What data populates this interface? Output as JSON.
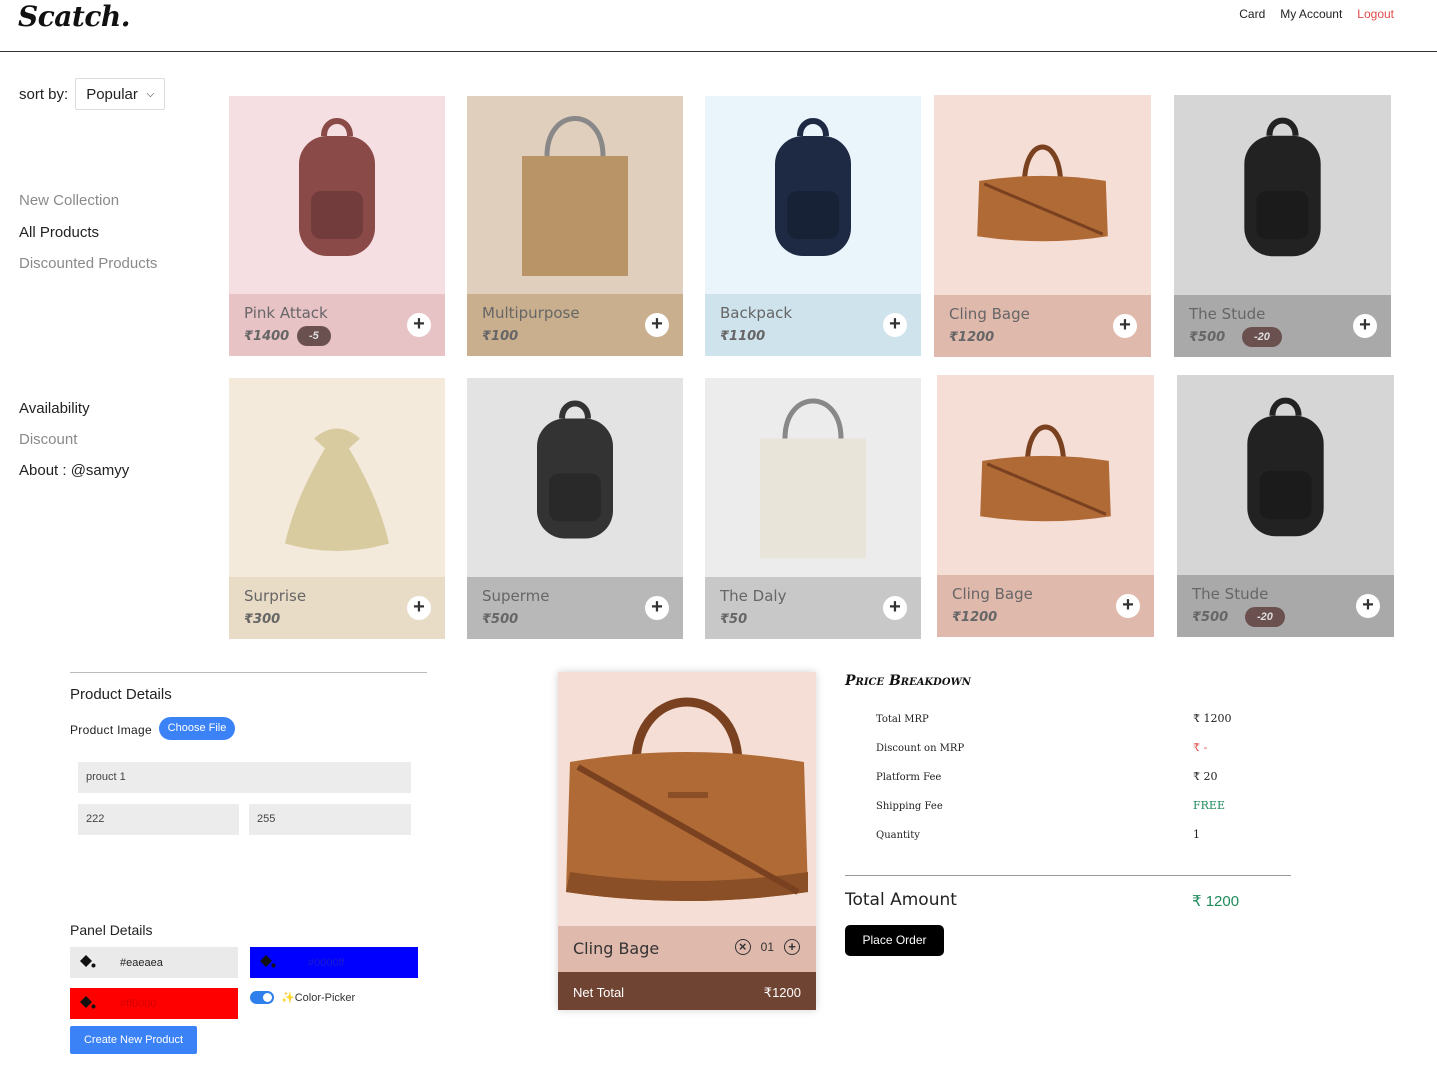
{
  "header": {
    "logo": "Scatch.",
    "nav": {
      "card": "Card",
      "account": "My Account",
      "logout": "Logout"
    }
  },
  "sidebar": {
    "sort_label": "sort by:",
    "sort_value": "Popular",
    "links": [
      "New Collection",
      "All Products",
      "Discounted Products"
    ],
    "links2": [
      "Availability",
      "Discount",
      "About : @samyy"
    ]
  },
  "products": [
    {
      "name": "Pink Attack",
      "price": "₹1400",
      "discount": "-5",
      "bg": "#f5dfe2",
      "panel": "#e8c3c6",
      "icon": "backpack-icon"
    },
    {
      "name": "Multipurpose",
      "price": "₹100",
      "discount": "",
      "bg": "#e0cfbd",
      "panel": "#c9af8e",
      "icon": "tote-bag-icon"
    },
    {
      "name": "Backpack",
      "price": "₹1100",
      "discount": "",
      "bg": "#eaf4fb",
      "panel": "#cfe3ec",
      "icon": "backpack-icon"
    },
    {
      "name": "Cling Bage",
      "price": "₹1200",
      "discount": "",
      "bg": "#f5ded5",
      "panel": "#e0b9ad",
      "icon": "duffel-bag-icon"
    },
    {
      "name": "The Stude",
      "price": "₹500",
      "discount": "-20",
      "bg": "#d6d6d6",
      "panel": "#a9a9a9",
      "icon": "backpack-icon"
    },
    {
      "name": "Surprise",
      "price": "₹300",
      "discount": "",
      "bg": "#f4eadb",
      "panel": "#e9dcc6",
      "icon": "pouch-icon"
    },
    {
      "name": "Superme",
      "price": "₹500",
      "discount": "",
      "bg": "#e3e3e3",
      "panel": "#b8b8b8",
      "icon": "backpack-icon"
    },
    {
      "name": "The Daly",
      "price": "₹50",
      "discount": "",
      "bg": "#ececec",
      "panel": "#c8c8c8",
      "icon": "tote-bag-icon"
    },
    {
      "name": "Cling Bage",
      "price": "₹1200",
      "discount": "",
      "bg": "#f5ded5",
      "panel": "#e0b9ad",
      "icon": "duffel-bag-icon"
    },
    {
      "name": "The Stude",
      "price": "₹500",
      "discount": "-20",
      "bg": "#d6d6d6",
      "panel": "#a9a9a9",
      "icon": "backpack-icon"
    }
  ],
  "product_form": {
    "title": "Product Details",
    "image_label": "Product Image",
    "choose_file": "Choose File",
    "name_value": "prouct 1",
    "price_value": "222",
    "discount_value": "255",
    "panel_title": "Panel Details",
    "bg_color": "#eaeaea",
    "panel_color": "#0000ff",
    "text_color": "#ff0000",
    "color_picker_label": "✨Color-Picker",
    "create_button": "Create New Product"
  },
  "cart": {
    "name": "Cling Bage",
    "quantity": "01",
    "net_label": "Net Total",
    "net_value": "₹1200"
  },
  "price_breakdown": {
    "title": "Price Breakdown",
    "rows": [
      {
        "label": "Total MRP",
        "value": "₹ 1200",
        "color": "#222222"
      },
      {
        "label": "Discount on MRP",
        "value": "₹ -",
        "color": "#e14b4b"
      },
      {
        "label": "Platform Fee",
        "value": "₹ 20",
        "color": "#222222"
      },
      {
        "label": "Shipping Fee",
        "value": "FREE",
        "color": "#1f8a5b"
      },
      {
        "label": "Quantity",
        "value": "1",
        "color": "#222222"
      }
    ],
    "total_label": "Total Amount",
    "total_value": "₹ 1200",
    "place_order": "Place Order"
  }
}
